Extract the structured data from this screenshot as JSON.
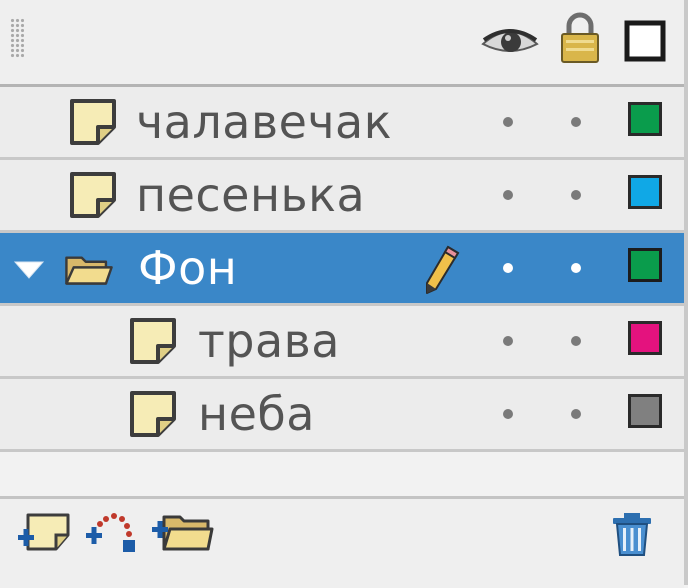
{
  "header": {
    "columns": [
      {
        "name": "show-hide",
        "icon": "eye-icon"
      },
      {
        "name": "lock",
        "icon": "lock-icon"
      },
      {
        "name": "outline",
        "icon": "outline-square-icon"
      }
    ]
  },
  "layers": [
    {
      "label": "чалавечак",
      "type": "layer",
      "color": "#0a9c4c",
      "selected": false,
      "indent": 0
    },
    {
      "label": "песенька",
      "type": "layer",
      "color": "#10a8e6",
      "selected": false,
      "indent": 0
    },
    {
      "label": "Фон",
      "type": "folder",
      "color": "#0a9c4c",
      "selected": true,
      "expanded": true,
      "editing": true,
      "indent": 0
    },
    {
      "label": "трава",
      "type": "layer",
      "color": "#e4127e",
      "selected": false,
      "indent": 1
    },
    {
      "label": "неба",
      "type": "layer",
      "color": "#808080",
      "selected": false,
      "indent": 1
    }
  ],
  "footer": {
    "buttons": [
      {
        "name": "new-layer-button",
        "icon": "new-layer-icon"
      },
      {
        "name": "add-motion-guide-button",
        "icon": "motion-guide-icon"
      },
      {
        "name": "new-folder-button",
        "icon": "new-folder-icon"
      },
      {
        "name": "delete-layer-button",
        "icon": "trash-icon"
      }
    ]
  }
}
